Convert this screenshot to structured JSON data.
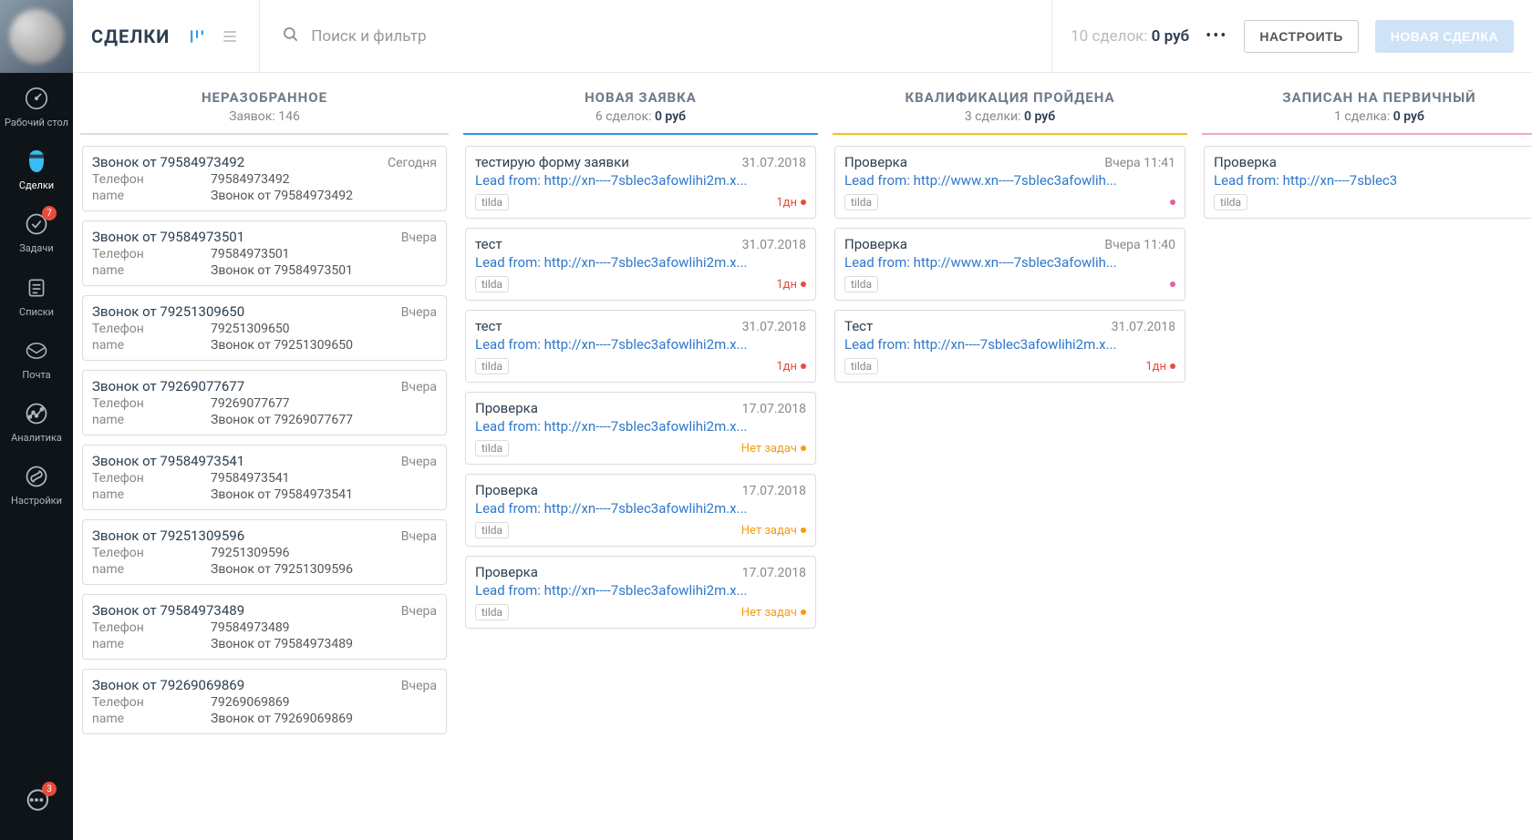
{
  "sidebar": {
    "items": [
      {
        "label": "Рабочий стол",
        "icon": "dashboard-icon"
      },
      {
        "label": "Сделки",
        "icon": "deals-icon",
        "active": true
      },
      {
        "label": "Задачи",
        "icon": "tasks-icon",
        "badge": "7"
      },
      {
        "label": "Списки",
        "icon": "lists-icon"
      },
      {
        "label": "Почта",
        "icon": "mail-icon"
      },
      {
        "label": "Аналитика",
        "icon": "analytics-icon"
      },
      {
        "label": "Настройки",
        "icon": "settings-icon"
      }
    ],
    "chat_badge": "3"
  },
  "header": {
    "title": "СДЕЛКИ",
    "search_placeholder": "Поиск и фильтр",
    "summary_prefix": "10 сделок: ",
    "summary_value": "0 руб",
    "settings_btn": "НАСТРОИТЬ",
    "new_deal_btn": "НОВАЯ СДЕЛКА"
  },
  "columns": [
    {
      "title": "НЕРАЗОБРАННОЕ",
      "sub": "Заявок: 146",
      "leads": [
        {
          "title": "Звонок от 79584973492",
          "date": "Сегодня",
          "phone_k": "Телефон",
          "phone": "79584973492",
          "name_k": "name",
          "name": "Звонок от 79584973492"
        },
        {
          "title": "Звонок от 79584973501",
          "date": "Вчера",
          "phone_k": "Телефон",
          "phone": "79584973501",
          "name_k": "name",
          "name": "Звонок от 79584973501"
        },
        {
          "title": "Звонок от 79251309650",
          "date": "Вчера",
          "phone_k": "Телефон",
          "phone": "79251309650",
          "name_k": "name",
          "name": "Звонок от 79251309650"
        },
        {
          "title": "Звонок от 79269077677",
          "date": "Вчера",
          "phone_k": "Телефон",
          "phone": "79269077677",
          "name_k": "name",
          "name": "Звонок от 79269077677"
        },
        {
          "title": "Звонок от 79584973541",
          "date": "Вчера",
          "phone_k": "Телефон",
          "phone": "79584973541",
          "name_k": "name",
          "name": "Звонок от 79584973541"
        },
        {
          "title": "Звонок от 79251309596",
          "date": "Вчера",
          "phone_k": "Телефон",
          "phone": "79251309596",
          "name_k": "name",
          "name": "Звонок от 79251309596"
        },
        {
          "title": "Звонок от 79584973489",
          "date": "Вчера",
          "phone_k": "Телефон",
          "phone": "79584973489",
          "name_k": "name",
          "name": "Звонок от 79584973489"
        },
        {
          "title": "Звонок от 79269069869",
          "date": "Вчера",
          "phone_k": "Телефон",
          "phone": "79269069869",
          "name_k": "name",
          "name": "Звонок от 79269069869"
        }
      ]
    },
    {
      "title": "НОВАЯ ЗАЯВКА",
      "sub_prefix": "6 сделок: ",
      "sub_value": "0 руб",
      "cards": [
        {
          "title": "тестирую форму заявки",
          "date": "31.07.2018",
          "link": "Lead from: http://xn----7sblec3afowlihi2m.x...",
          "tag": "tilda",
          "status": "1дн",
          "status_class": "red"
        },
        {
          "title": "тест",
          "date": "31.07.2018",
          "link": "Lead from: http://xn----7sblec3afowlihi2m.x...",
          "tag": "tilda",
          "status": "1дн",
          "status_class": "red"
        },
        {
          "title": "тест",
          "date": "31.07.2018",
          "link": "Lead from: http://xn----7sblec3afowlihi2m.x...",
          "tag": "tilda",
          "status": "1дн",
          "status_class": "red"
        },
        {
          "title": "Проверка",
          "date": "17.07.2018",
          "link": "Lead from: http://xn----7sblec3afowlihi2m.x...",
          "tag": "tilda",
          "status": "Нет задач",
          "status_class": "orange"
        },
        {
          "title": "Проверка",
          "date": "17.07.2018",
          "link": "Lead from: http://xn----7sblec3afowlihi2m.x...",
          "tag": "tilda",
          "status": "Нет задач",
          "status_class": "orange"
        },
        {
          "title": "Проверка",
          "date": "17.07.2018",
          "link": "Lead from: http://xn----7sblec3afowlihi2m.x...",
          "tag": "tilda",
          "status": "Нет задач",
          "status_class": "orange"
        }
      ]
    },
    {
      "title": "КВАЛИФИКАЦИЯ ПРОЙДЕНА",
      "sub_prefix": "3 сделки: ",
      "sub_value": "0 руб",
      "cards": [
        {
          "title": "Проверка",
          "date": "Вчера 11:41",
          "link": "Lead from: http://www.xn----7sblec3afowlih...",
          "tag": "tilda",
          "status": "",
          "status_class": "pink"
        },
        {
          "title": "Проверка",
          "date": "Вчера 11:40",
          "link": "Lead from: http://www.xn----7sblec3afowlih...",
          "tag": "tilda",
          "status": "",
          "status_class": "pink"
        },
        {
          "title": "Тест",
          "date": "31.07.2018",
          "link": "Lead from: http://xn----7sblec3afowlihi2m.x...",
          "tag": "tilda",
          "status": "1дн",
          "status_class": "red"
        }
      ]
    },
    {
      "title": "ЗАПИСАН НА ПЕРВИЧНЫЙ",
      "sub_prefix": "1 сделка: ",
      "sub_value": "0 руб",
      "cards": [
        {
          "title": "Проверка",
          "date": "",
          "link": "Lead from: http://xn----7sblec3",
          "tag": "tilda",
          "status": "",
          "status_class": ""
        }
      ]
    }
  ]
}
